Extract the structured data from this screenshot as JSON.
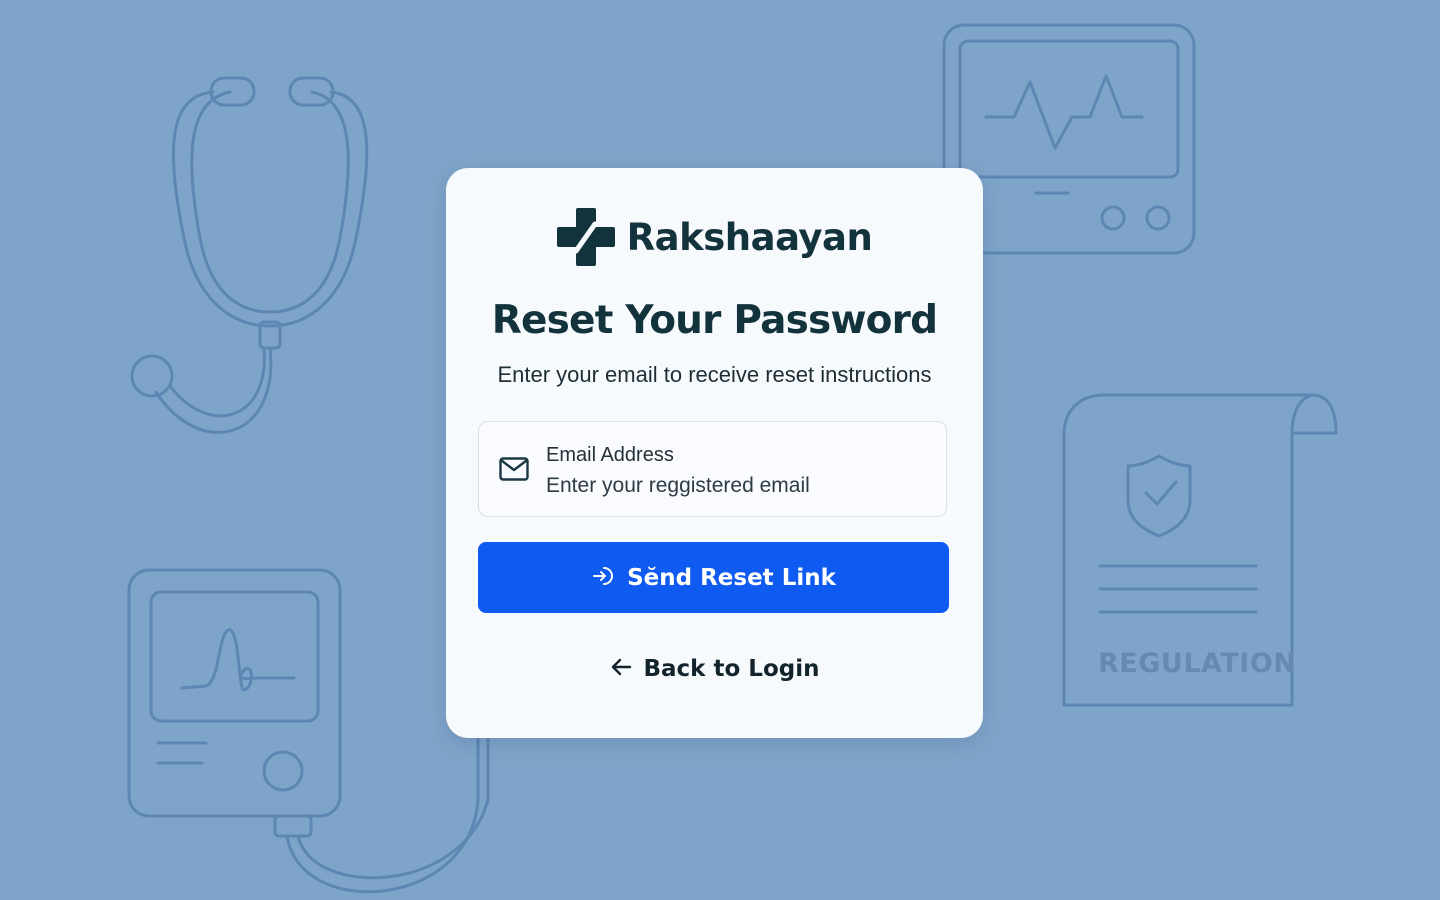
{
  "background": {
    "color": "#7fa4c9",
    "stroke_color": "#5d87b3",
    "decorations": [
      "stethoscope-icon",
      "ecg-monitor-icon",
      "regulation-document-icon",
      "signature-device-icon"
    ],
    "regulation_label": "REGULATION"
  },
  "brand": {
    "name": "Rakshaayan",
    "logo_icon": "medical-cross-icon",
    "logo_color": "#12323c"
  },
  "form": {
    "title": "Reset Your Password",
    "subtitle": "Enter your email to receive reset instructions",
    "email": {
      "label": "Email Address",
      "placeholder": "Enter your reggistered email",
      "value": "",
      "icon": "mail-icon"
    },
    "submit": {
      "label": "Sĕnd Reset Link",
      "icon": "login-arrow-icon",
      "color": "#0f5af0"
    },
    "back": {
      "label": "Back to Login",
      "icon": "arrow-left-icon"
    }
  }
}
